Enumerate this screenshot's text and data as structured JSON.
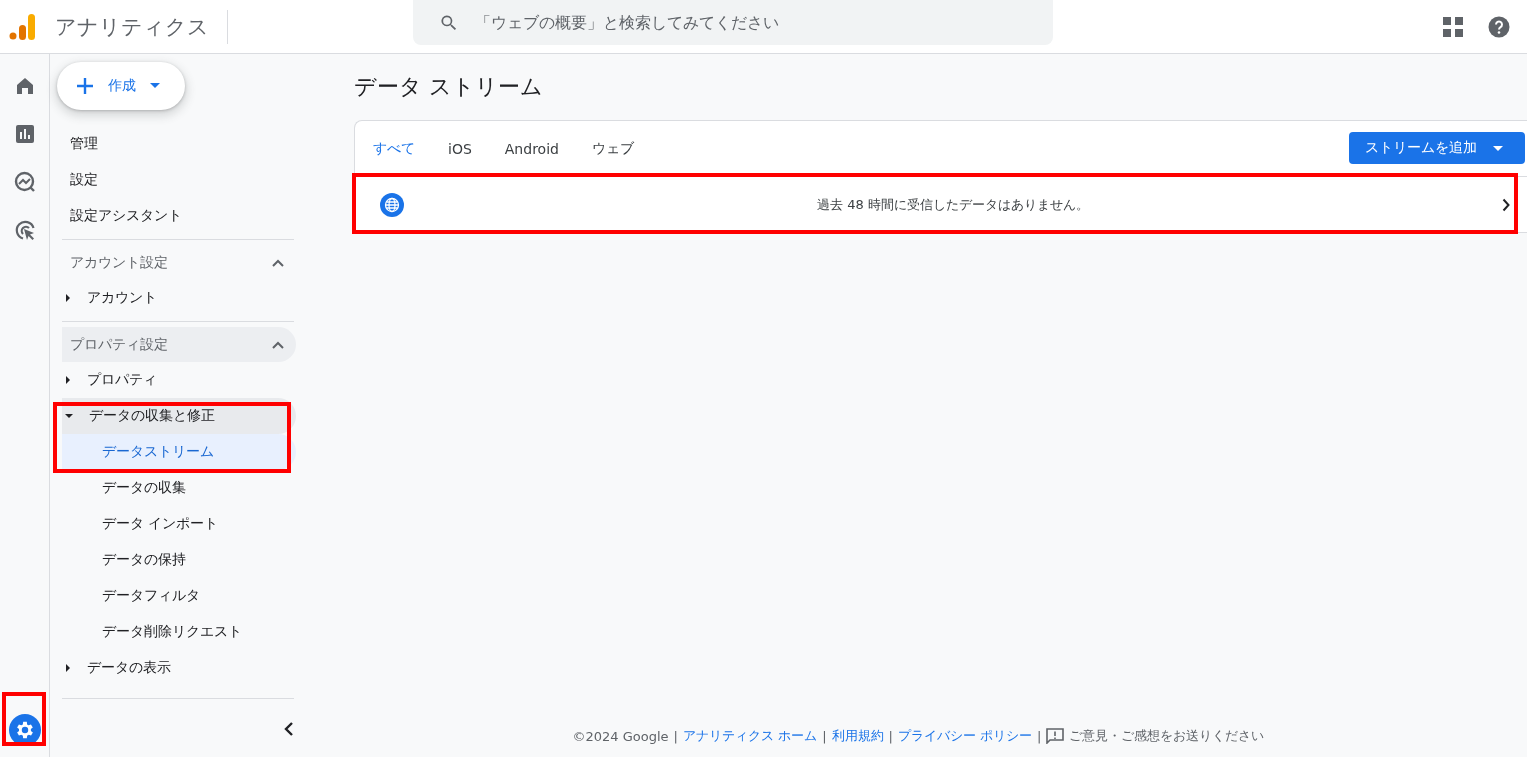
{
  "app": {
    "title": "アナリティクス"
  },
  "search": {
    "placeholder": "「ウェブの概要」と検索してみてください"
  },
  "rail": [
    {
      "kind": "home",
      "selected": false
    },
    {
      "kind": "reports",
      "selected": false
    },
    {
      "kind": "explore",
      "selected": false
    },
    {
      "kind": "advertising",
      "selected": false
    },
    {
      "kind": "admin",
      "selected": true
    }
  ],
  "create_button": {
    "label": "作成"
  },
  "sidebar": {
    "items": [
      {
        "label": "管理"
      },
      {
        "label": "設定"
      },
      {
        "label": "設定アシスタント"
      }
    ],
    "sections": [
      {
        "title": "アカウント設定",
        "expanded": true,
        "highlighted": false,
        "items": [
          {
            "label": "アカウント",
            "expanded": false,
            "highlighted": false
          }
        ]
      },
      {
        "title": "プロパティ設定",
        "expanded": true,
        "highlighted": true,
        "items": [
          {
            "label": "プロパティ",
            "expanded": false,
            "highlighted": false
          },
          {
            "label": "データの収集と修正",
            "expanded": true,
            "highlighted": true,
            "children": [
              {
                "label": "データストリーム",
                "selected": true
              },
              {
                "label": "データの収集",
                "selected": false
              },
              {
                "label": "データ インポート",
                "selected": false
              },
              {
                "label": "データの保持",
                "selected": false
              },
              {
                "label": "データフィルタ",
                "selected": false
              },
              {
                "label": "データ削除リクエスト",
                "selected": false
              }
            ]
          },
          {
            "label": "データの表示",
            "expanded": false,
            "highlighted": false
          }
        ]
      }
    ]
  },
  "page_title": "データ ストリーム",
  "tabs": [
    {
      "label": "すべて",
      "selected": true
    },
    {
      "label": "iOS",
      "selected": false
    },
    {
      "label": "Android",
      "selected": false
    },
    {
      "label": "ウェブ",
      "selected": false
    }
  ],
  "add_button": {
    "label": "ストリームを追加"
  },
  "streams": [
    {
      "kind": "web",
      "message": "過去 48 時間に受信したデータはありません。"
    }
  ],
  "footer": [
    {
      "kind": "text",
      "text": "©2024 Google"
    },
    {
      "kind": "separator",
      "text": "|"
    },
    {
      "kind": "link",
      "text": "アナリティクス ホーム"
    },
    {
      "kind": "separator",
      "text": "|"
    },
    {
      "kind": "link",
      "text": "利用規約"
    },
    {
      "kind": "separator",
      "text": "|"
    },
    {
      "kind": "link",
      "text": "プライバシー ポリシー"
    },
    {
      "kind": "separator",
      "text": "|"
    },
    {
      "kind": "feedback",
      "text": "ご意見・ご感想をお送りください"
    }
  ]
}
